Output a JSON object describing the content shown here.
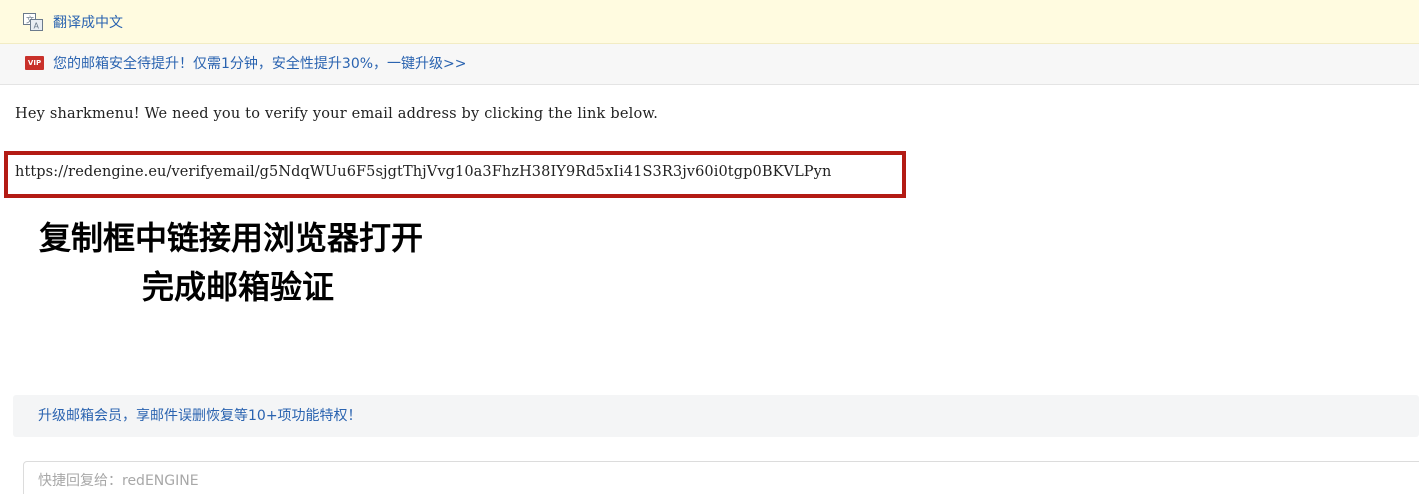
{
  "translate_bar": {
    "icon": "translate-icon",
    "link_text": "翻译成中文"
  },
  "vip_bar": {
    "badge_text": "VIP",
    "badge_color": "#c9312a",
    "link_text": "您的邮箱安全待提升！仅需1分钟，安全性提升30%，一键升级>>"
  },
  "message": {
    "body_text": "Hey sharkmenu! We need you to verify your email address by clicking the link below.",
    "verify_url": "https://redengine.eu/verifyemail/g5NdqWUu6F5sjgtThjVvg10a3FhzH38IY9Rd5xIi41S3R3jv60i0tgp0BKVLPyn",
    "highlight_color": "#b31b14",
    "annotation_line1": "复制框中链接用浏览器打开",
    "annotation_line2": "完成邮箱验证"
  },
  "upgrade_banner": {
    "text": "升级邮箱会员，享邮件误删恢复等10+项功能特权！"
  },
  "quick_reply": {
    "placeholder": "快捷回复给：redENGINE",
    "value": ""
  },
  "colors": {
    "link": "#2a63b0",
    "translate_bar_bg": "#fffbe0",
    "vip_bar_bg": "#f7f7f7"
  }
}
